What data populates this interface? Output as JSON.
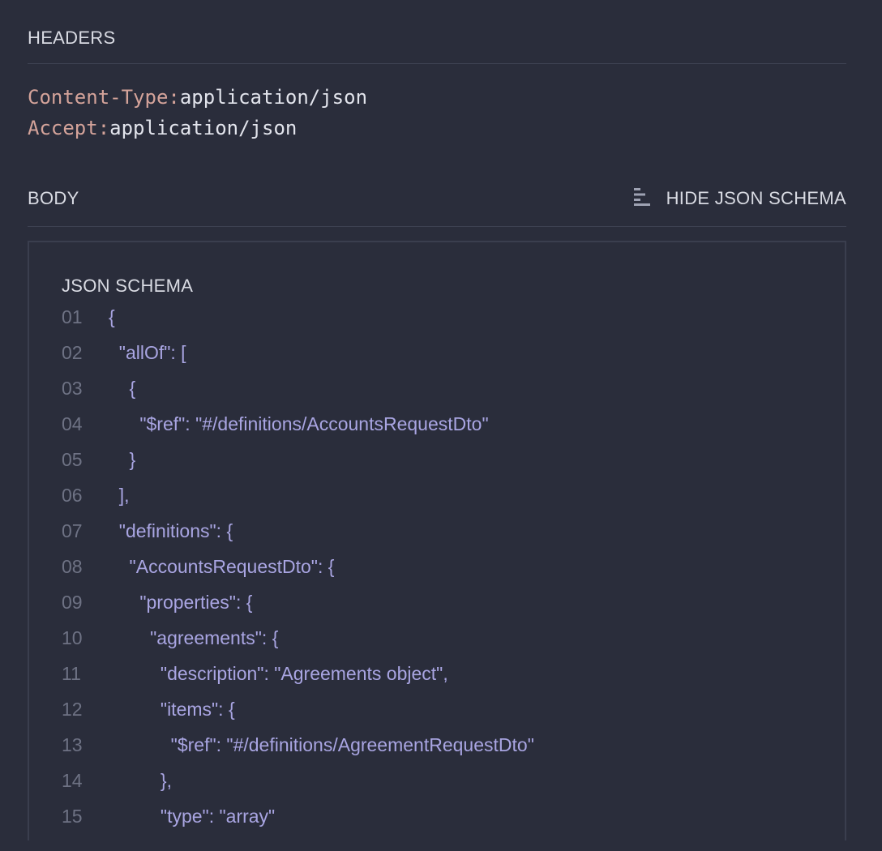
{
  "headers": {
    "title": "HEADERS",
    "items": [
      {
        "key": "Content-Type:",
        "value": "application/json"
      },
      {
        "key": "Accept:",
        "value": "application/json"
      }
    ]
  },
  "body": {
    "title": "BODY",
    "toggle_label": "HIDE JSON SCHEMA",
    "toggle_icon": "list-icon"
  },
  "schema": {
    "title": "JSON SCHEMA",
    "lines": [
      {
        "num": "01",
        "text": "{"
      },
      {
        "num": "02",
        "text": "  \"allOf\": ["
      },
      {
        "num": "03",
        "text": "    {"
      },
      {
        "num": "04",
        "text": "      \"$ref\": \"#/definitions/AccountsRequestDto\""
      },
      {
        "num": "05",
        "text": "    }"
      },
      {
        "num": "06",
        "text": "  ],"
      },
      {
        "num": "07",
        "text": "  \"definitions\": {"
      },
      {
        "num": "08",
        "text": "    \"AccountsRequestDto\": {"
      },
      {
        "num": "09",
        "text": "      \"properties\": {"
      },
      {
        "num": "10",
        "text": "        \"agreements\": {"
      },
      {
        "num": "11",
        "text": "          \"description\": \"Agreements object\","
      },
      {
        "num": "12",
        "text": "          \"items\": {"
      },
      {
        "num": "13",
        "text": "            \"$ref\": \"#/definitions/AgreementRequestDto\""
      },
      {
        "num": "14",
        "text": "          },"
      },
      {
        "num": "15",
        "text": "          \"type\": \"array\""
      }
    ]
  },
  "colors": {
    "background": "#2a2d3b",
    "header_key": "#d4a39a",
    "code_text": "#a9a5e2",
    "line_number": "#6e7284"
  }
}
